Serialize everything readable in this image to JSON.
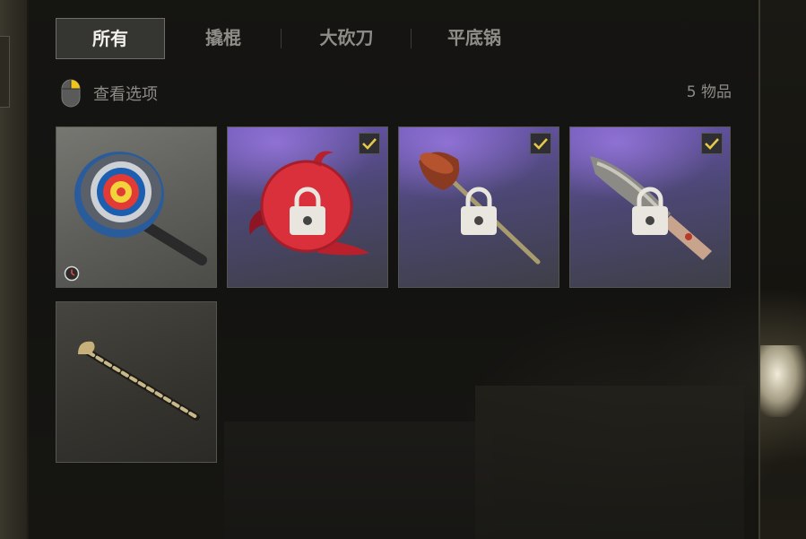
{
  "tabs": [
    {
      "label": "所有",
      "active": true
    },
    {
      "label": "撬棍",
      "active": false
    },
    {
      "label": "大砍刀",
      "active": false
    },
    {
      "label": "平底锅",
      "active": false
    }
  ],
  "view_options": {
    "label": "查看选项",
    "icon": "mouse-icon"
  },
  "item_count": "5 物品",
  "items": [
    {
      "name": "target-pan",
      "icon": "frying-pan-icon",
      "owned": false,
      "locked": false,
      "timed": true
    },
    {
      "name": "devil-pan",
      "icon": "red-pan-icon",
      "owned": true,
      "locked": true,
      "timed": false
    },
    {
      "name": "plunger",
      "icon": "plunger-icon",
      "owned": true,
      "locked": true,
      "timed": false
    },
    {
      "name": "machete",
      "icon": "machete-icon",
      "owned": true,
      "locked": true,
      "timed": false
    },
    {
      "name": "crowbar",
      "icon": "crowbar-icon",
      "owned": false,
      "locked": false,
      "timed": false
    }
  ],
  "colors": {
    "accent_check": "#e8c84a",
    "tab_active_bg": "#46463f",
    "tile_purple": "#6a55b0",
    "mouse_highlight": "#f0c419"
  }
}
